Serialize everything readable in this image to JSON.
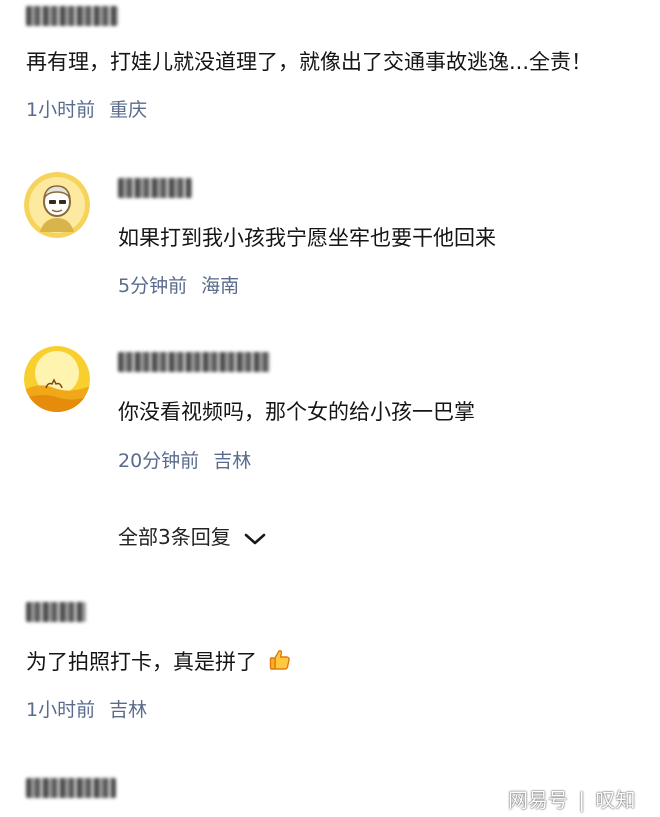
{
  "comments": [
    {
      "text": "再有理，打娃儿就没道理了，就像出了交通事故逃逸...全责！",
      "time": "1小时前",
      "location": "重庆",
      "replies": [
        {
          "text": "如果打到我小孩我宁愿坐牢也要干他回来",
          "time": "5分钟前",
          "location": "海南"
        },
        {
          "text": "你没看视频吗，那个女的给小孩一巴掌",
          "time": "20分钟前",
          "location": "吉林"
        }
      ],
      "more_replies_label": "全部3条回复"
    },
    {
      "text": "为了拍照打卡，真是拼了",
      "time": "1小时前",
      "location": "吉林"
    }
  ],
  "watermark": {
    "source": "网易号",
    "separator": "|",
    "author": "叹知"
  },
  "colors": {
    "meta": "#5a6b8c",
    "text": "#151515"
  },
  "icons": {
    "emoji": "thumbs-up-icon",
    "expand": "chevron-down-icon"
  }
}
